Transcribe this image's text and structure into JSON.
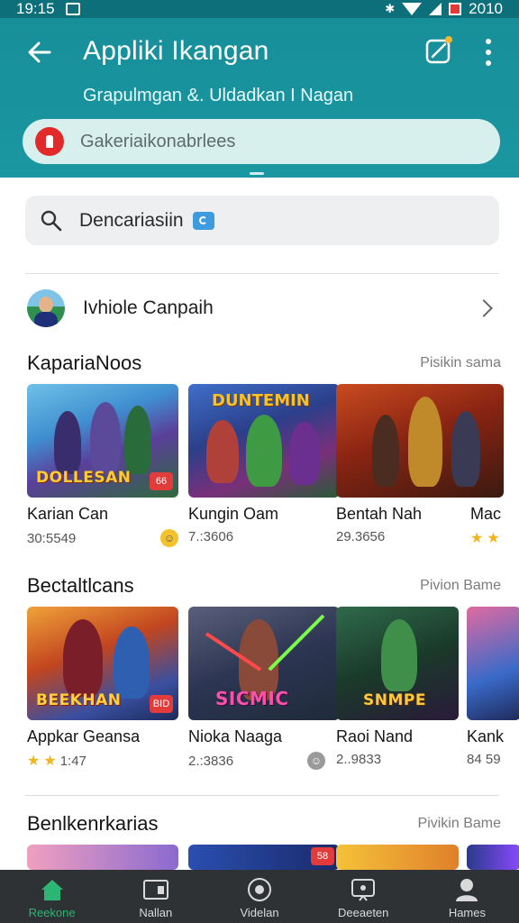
{
  "status_bar": {
    "time": "19:15",
    "battery_text": "2010"
  },
  "header": {
    "title": "Appliki Ikangan",
    "subtitle": "Grapulmgan &. Uldadkan I Nagan",
    "top_search_placeholder": "Gakeriaikonabrlees",
    "colors": {
      "header_bg": "#1a97a1",
      "status_bg": "#0c6f79"
    }
  },
  "search": {
    "query": "Dencariasiin"
  },
  "profile": {
    "name": "Ivhiole Canpaih"
  },
  "sections": [
    {
      "title": "KapariaNoos",
      "more": "Pisikin sama",
      "cards": [
        {
          "name": "Karian Can",
          "meta": "30:5549",
          "thumb_text": "DOLLESAN",
          "thumb_tag": "66"
        },
        {
          "name": "Kungin Oam",
          "meta": "7.:3606",
          "thumb_top_text": "DUNTEMIN"
        },
        {
          "name": "Bentah Nah",
          "meta": "29.3656"
        },
        {
          "name": "Mac",
          "meta": ""
        }
      ]
    },
    {
      "title": "Bectaltlcans",
      "more": "Pivion Bame",
      "cards": [
        {
          "name": "Appkar Geansa",
          "meta": "1:47",
          "thumb_text": "BEEKHAN",
          "thumb_tag": "BID"
        },
        {
          "name": "Nioka Naaga",
          "meta": "2.:3836",
          "thumb_text": "SICMIC"
        },
        {
          "name": "Raoi Nand",
          "meta": "2..9833",
          "thumb_text": "SNMPE"
        },
        {
          "name": "Kank",
          "meta": "84 59"
        }
      ]
    },
    {
      "title": "Benlkenrkarias",
      "more": "Pivikin Bame",
      "tags": [
        "58"
      ]
    }
  ],
  "bottom_nav": [
    {
      "label": "Reekone",
      "icon": "home-icon",
      "active": true
    },
    {
      "label": "Nallan",
      "icon": "library-icon",
      "active": false
    },
    {
      "label": "Videlan",
      "icon": "video-icon",
      "active": false
    },
    {
      "label": "Deeaeten",
      "icon": "media-icon",
      "active": false
    },
    {
      "label": "Hames",
      "icon": "profile-icon",
      "active": false
    }
  ]
}
